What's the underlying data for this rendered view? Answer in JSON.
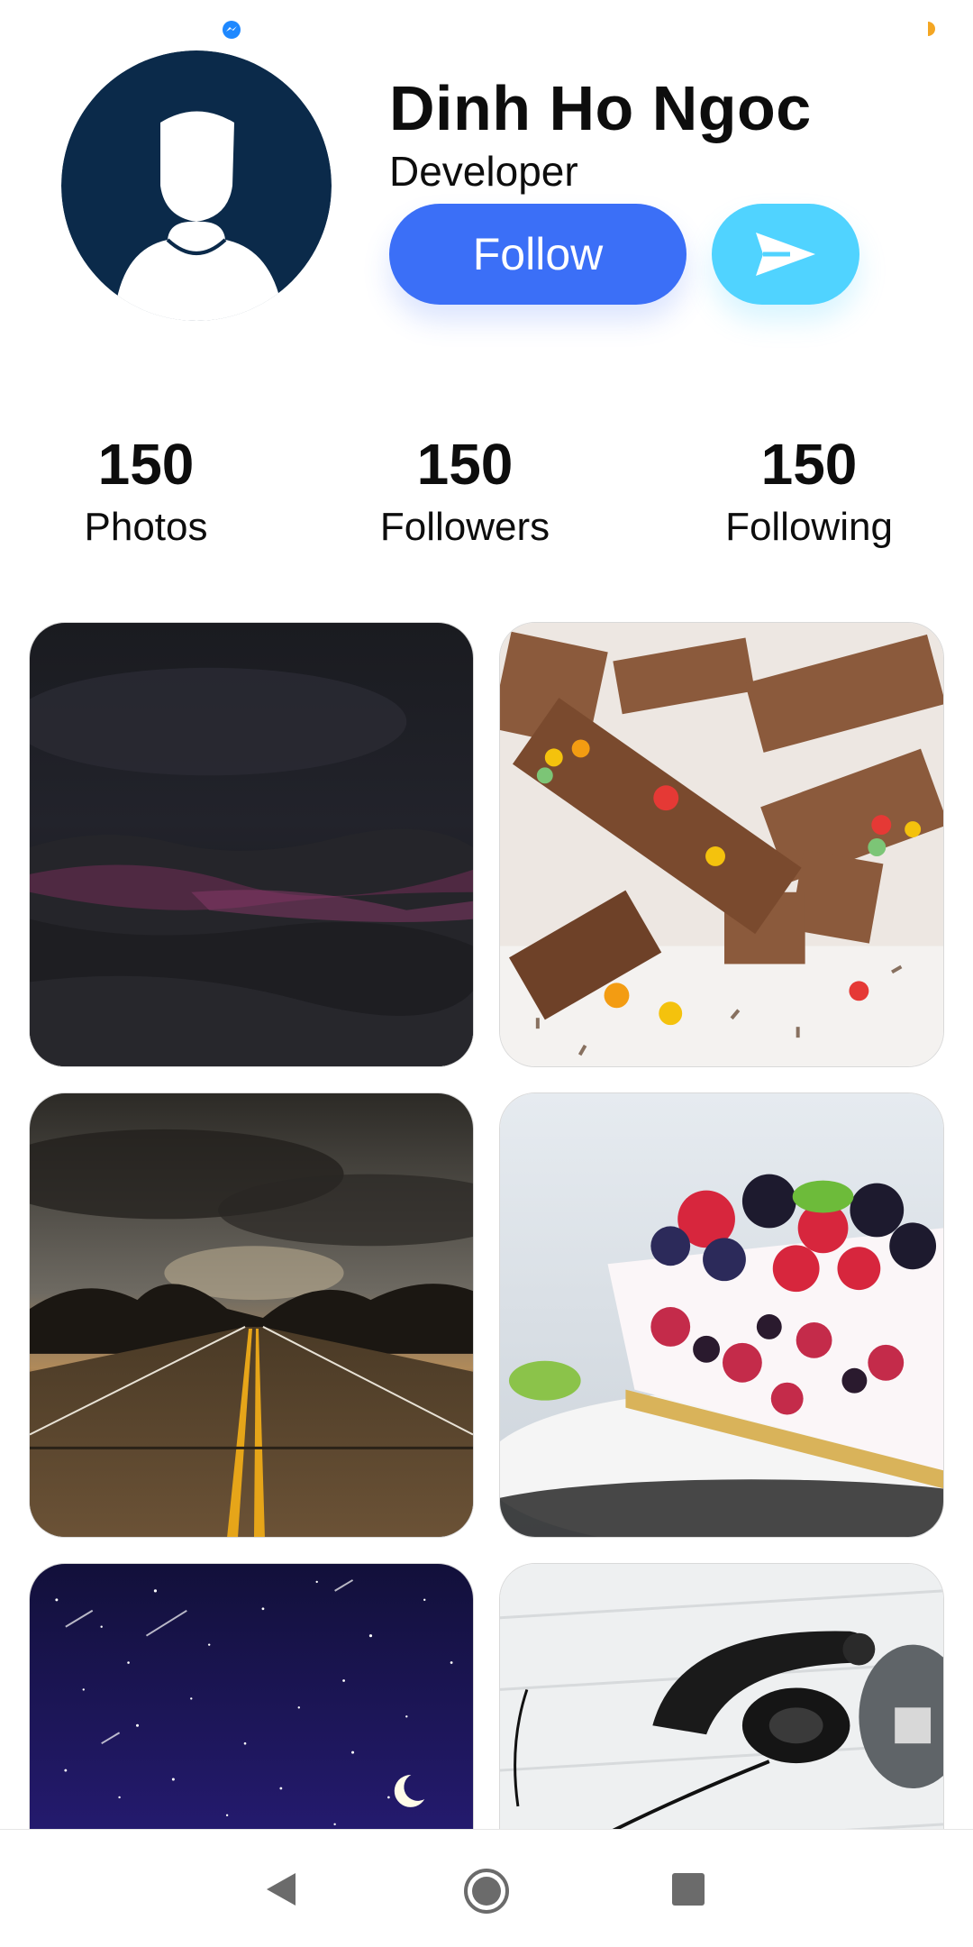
{
  "profile": {
    "name": "Dinh Ho Ngoc",
    "role": "Developer",
    "follow_label": "Follow"
  },
  "stats": [
    {
      "value": "150",
      "label": "Photos"
    },
    {
      "value": "150",
      "label": "Followers"
    },
    {
      "value": "150",
      "label": "Following"
    }
  ],
  "colors": {
    "follow_button": "#3b6ff7",
    "send_button": "#50d3ff",
    "avatar_bg": "#0b2a4a"
  },
  "icons": {
    "status_left": "messenger-icon",
    "send": "send-icon",
    "nav_back": "back-triangle-icon",
    "nav_home": "home-circle-icon",
    "nav_recent": "recent-apps-square-icon"
  },
  "photos": [
    {
      "subject": "dark-landscape"
    },
    {
      "subject": "chocolate-bars"
    },
    {
      "subject": "road-sunset"
    },
    {
      "subject": "berry-cheesecake"
    },
    {
      "subject": "starry-night"
    },
    {
      "subject": "headphones"
    }
  ]
}
